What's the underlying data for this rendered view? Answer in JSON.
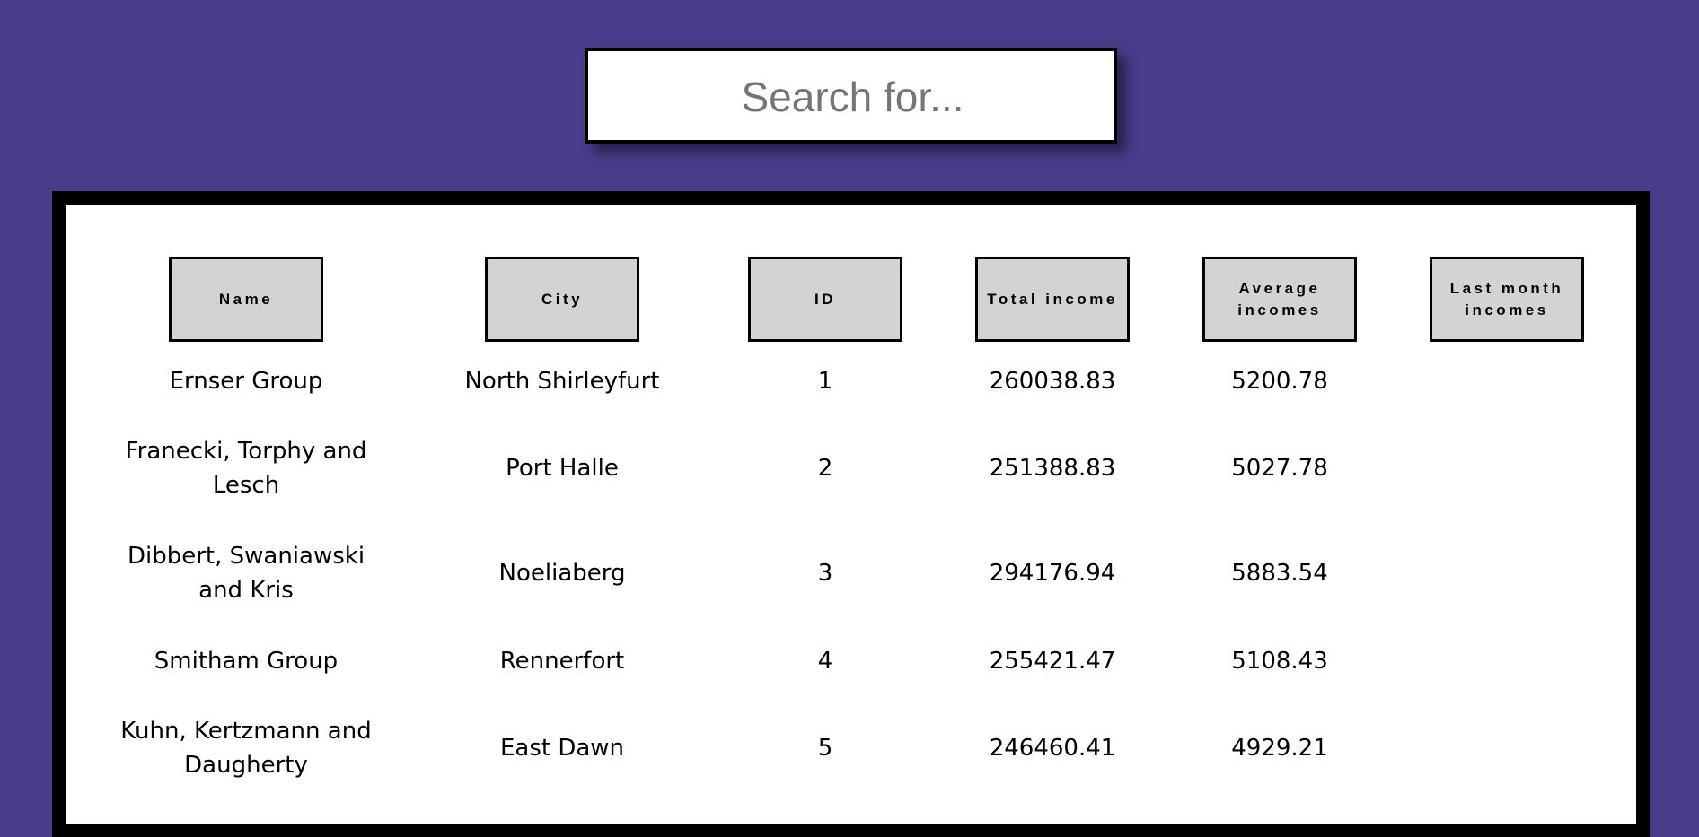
{
  "search": {
    "placeholder": "Search for..."
  },
  "table": {
    "headers": [
      "Name",
      "City",
      "ID",
      "Total income",
      "Average incomes",
      "Last month incomes"
    ],
    "rows": [
      {
        "name": "Ernser Group",
        "city": "North Shirleyfurt",
        "id": "1",
        "total": "260038.83",
        "average": "5200.78",
        "last_month": ""
      },
      {
        "name": "Franecki, Torphy and Lesch",
        "city": "Port Halle",
        "id": "2",
        "total": "251388.83",
        "average": "5027.78",
        "last_month": ""
      },
      {
        "name": "Dibbert, Swaniawski and Kris",
        "city": "Noeliaberg",
        "id": "3",
        "total": "294176.94",
        "average": "5883.54",
        "last_month": ""
      },
      {
        "name": "Smitham Group",
        "city": "Rennerfort",
        "id": "4",
        "total": "255421.47",
        "average": "5108.43",
        "last_month": ""
      },
      {
        "name": "Kuhn, Kertzmann and Daugherty",
        "city": "East Dawn",
        "id": "5",
        "total": "246460.41",
        "average": "4929.21",
        "last_month": ""
      }
    ]
  },
  "colors": {
    "background": "#483d8b",
    "header_fill": "#d3d3d3",
    "frame": "#000000"
  }
}
